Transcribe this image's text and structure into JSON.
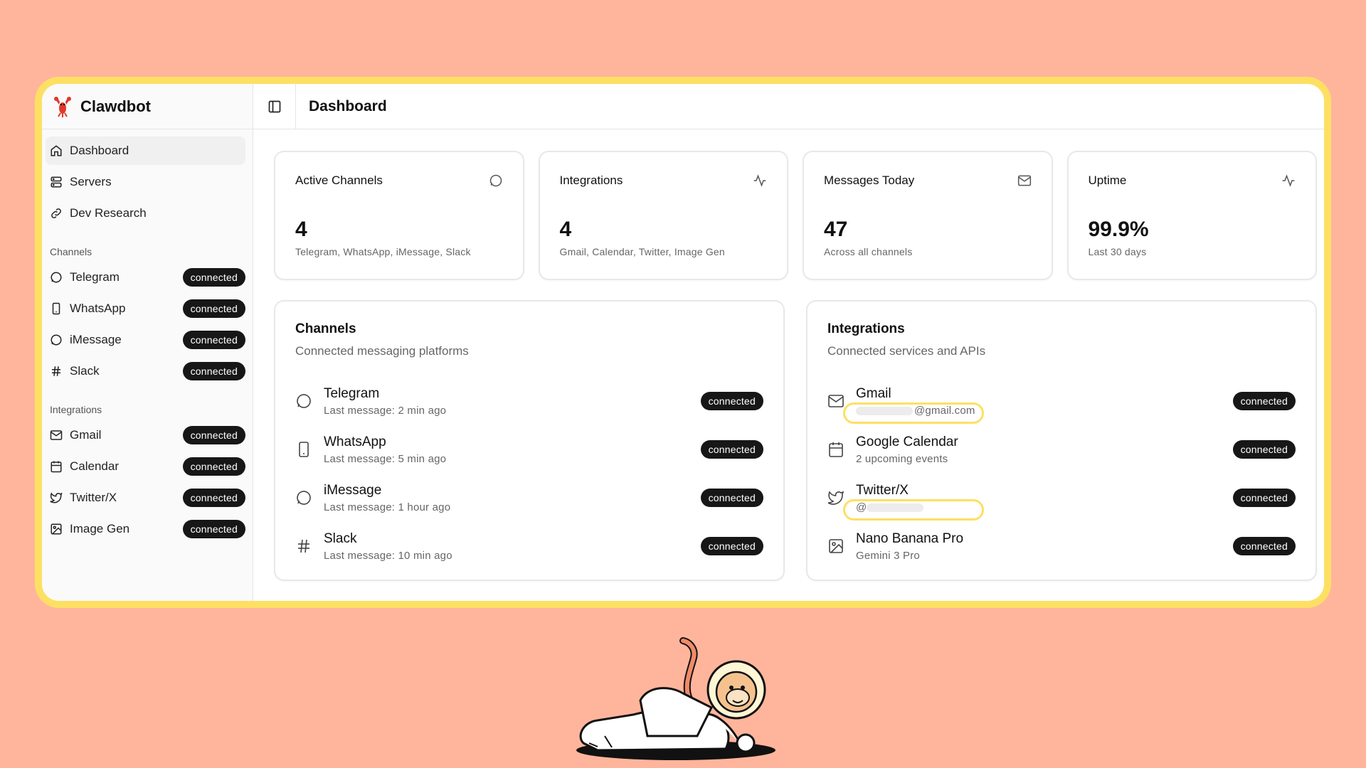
{
  "brand": {
    "name": "Clawdbot"
  },
  "header": {
    "title": "Dashboard"
  },
  "sidebar": {
    "nav": [
      {
        "label": "Dashboard",
        "icon": "home-icon",
        "active": true
      },
      {
        "label": "Servers",
        "icon": "server-icon"
      },
      {
        "label": "Dev Research",
        "icon": "link-icon"
      }
    ],
    "channels_label": "Channels",
    "channels": [
      {
        "label": "Telegram",
        "icon": "chat-bubble-icon",
        "status": "connected"
      },
      {
        "label": "WhatsApp",
        "icon": "phone-icon",
        "status": "connected"
      },
      {
        "label": "iMessage",
        "icon": "chat-bubble-icon",
        "status": "connected"
      },
      {
        "label": "Slack",
        "icon": "hash-icon",
        "status": "connected"
      }
    ],
    "integrations_label": "Integrations",
    "integrations": [
      {
        "label": "Gmail",
        "icon": "mail-icon",
        "status": "connected"
      },
      {
        "label": "Calendar",
        "icon": "calendar-icon",
        "status": "connected"
      },
      {
        "label": "Twitter/X",
        "icon": "twitter-icon",
        "status": "connected"
      },
      {
        "label": "Image Gen",
        "icon": "image-icon",
        "status": "connected"
      }
    ]
  },
  "stats": [
    {
      "title": "Active Channels",
      "value": "4",
      "sub": "Telegram, WhatsApp, iMessage, Slack",
      "icon": "chat-bubble-icon"
    },
    {
      "title": "Integrations",
      "value": "4",
      "sub": "Gmail, Calendar, Twitter, Image Gen",
      "icon": "activity-icon"
    },
    {
      "title": "Messages Today",
      "value": "47",
      "sub": "Across all channels",
      "icon": "mail-icon"
    },
    {
      "title": "Uptime",
      "value": "99.9%",
      "sub": "Last 30 days",
      "icon": "activity-icon"
    }
  ],
  "channels_panel": {
    "title": "Channels",
    "subtitle": "Connected messaging platforms",
    "items": [
      {
        "name": "Telegram",
        "meta": "Last message: 2 min ago",
        "status": "connected",
        "icon": "chat-bubble-icon"
      },
      {
        "name": "WhatsApp",
        "meta": "Last message: 5 min ago",
        "status": "connected",
        "icon": "phone-icon"
      },
      {
        "name": "iMessage",
        "meta": "Last message: 1 hour ago",
        "status": "connected",
        "icon": "chat-bubble-icon"
      },
      {
        "name": "Slack",
        "meta": "Last message: 10 min ago",
        "status": "connected",
        "icon": "hash-icon"
      }
    ]
  },
  "integrations_panel": {
    "title": "Integrations",
    "subtitle": "Connected services and APIs",
    "items": [
      {
        "name": "Gmail",
        "meta": "@gmail.com",
        "status": "connected",
        "icon": "mail-icon"
      },
      {
        "name": "Google Calendar",
        "meta": "2 upcoming events",
        "status": "connected",
        "icon": "calendar-icon"
      },
      {
        "name": "Twitter/X",
        "meta": "@",
        "status": "connected",
        "icon": "twitter-icon"
      },
      {
        "name": "Nano Banana Pro",
        "meta": "Gemini 3 Pro",
        "status": "connected",
        "icon": "image-icon"
      }
    ]
  },
  "colors": {
    "background": "#ffb59c",
    "highlight": "#fde063",
    "pill": "#171717"
  }
}
